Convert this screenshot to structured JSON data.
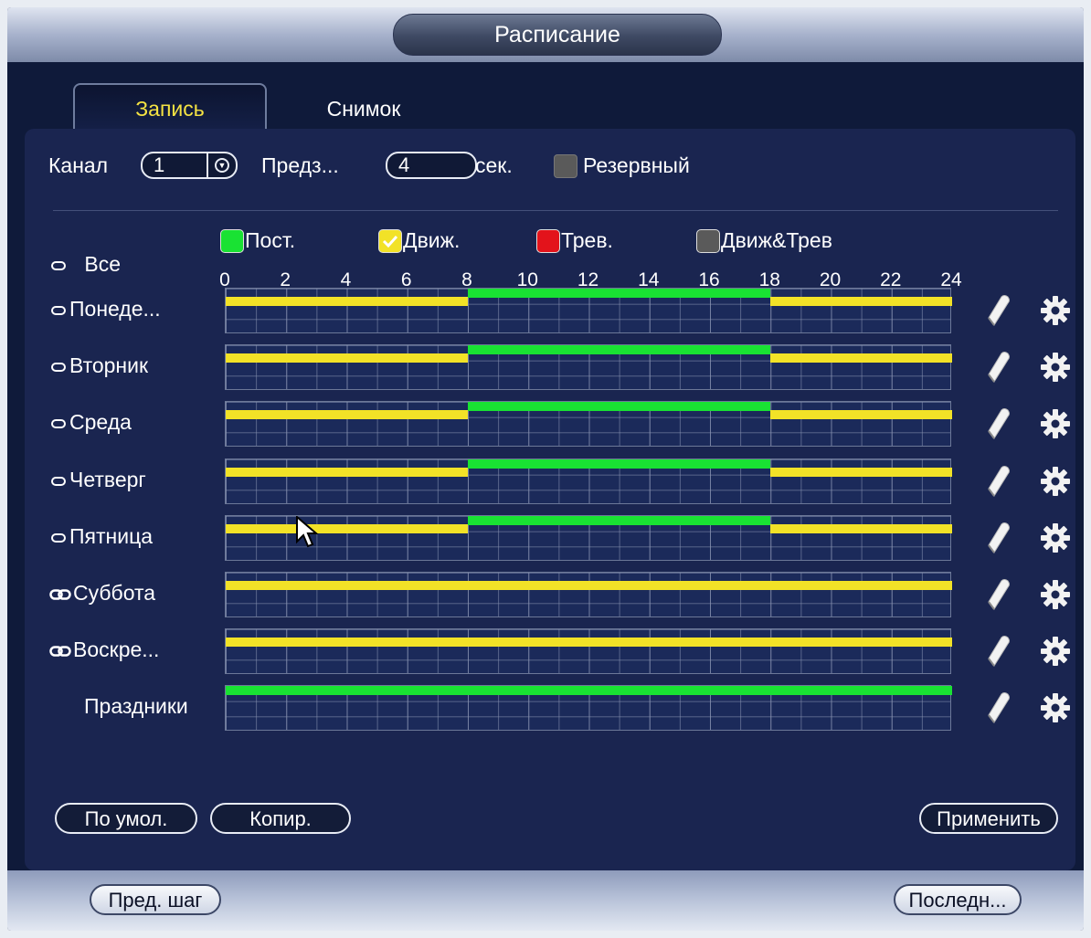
{
  "window": {
    "title": "Расписание"
  },
  "tabs": [
    {
      "label": "Запись",
      "active": true
    },
    {
      "label": "Снимок",
      "active": false
    }
  ],
  "controls": {
    "channel_label": "Канал",
    "channel_value": "1",
    "prerecord_label": "Предз...",
    "prerecord_value": "4",
    "prerecord_unit": "сек.",
    "redundant_label": "Резервный"
  },
  "legend": {
    "all_label": "Все",
    "items": [
      {
        "label": "Пост.",
        "color": "#19e233"
      },
      {
        "label": "Движ.",
        "color": "#f2e227",
        "checked": true
      },
      {
        "label": "Трев.",
        "color": "#e3131b"
      },
      {
        "label": "Движ&Трев",
        "color": "#5a5a5a"
      }
    ]
  },
  "hours": [
    "0",
    "2",
    "4",
    "6",
    "8",
    "10",
    "12",
    "14",
    "16",
    "18",
    "20",
    "22",
    "24"
  ],
  "colors": {
    "constant": "#19e233",
    "motion": "#f2e227"
  },
  "days": [
    {
      "label": "Понеде...",
      "icon": "unlinked",
      "motion": [
        [
          0,
          8
        ],
        [
          18,
          24
        ]
      ],
      "constant": [
        [
          8,
          18
        ]
      ]
    },
    {
      "label": "Вторник",
      "icon": "unlinked",
      "motion": [
        [
          0,
          8
        ],
        [
          18,
          24
        ]
      ],
      "constant": [
        [
          8,
          18
        ]
      ]
    },
    {
      "label": "Среда",
      "icon": "unlinked",
      "motion": [
        [
          0,
          8
        ],
        [
          18,
          24
        ]
      ],
      "constant": [
        [
          8,
          18
        ]
      ]
    },
    {
      "label": "Четверг",
      "icon": "unlinked",
      "motion": [
        [
          0,
          8
        ],
        [
          18,
          24
        ]
      ],
      "constant": [
        [
          8,
          18
        ]
      ]
    },
    {
      "label": "Пятница",
      "icon": "unlinked",
      "motion": [
        [
          0,
          8
        ],
        [
          18,
          24
        ]
      ],
      "constant": [
        [
          8,
          18
        ]
      ]
    },
    {
      "label": "Суббота",
      "icon": "linked",
      "motion": [
        [
          0,
          24
        ]
      ],
      "constant": []
    },
    {
      "label": "Воскре...",
      "icon": "linked",
      "motion": [
        [
          0,
          24
        ]
      ],
      "constant": []
    },
    {
      "label": "Праздники",
      "icon": "none",
      "motion": [],
      "constant": [
        [
          0,
          24
        ]
      ]
    }
  ],
  "buttons": {
    "default": "По умол.",
    "copy": "Копир.",
    "apply": "Применить",
    "prev": "Пред. шаг",
    "last": "Последн..."
  }
}
